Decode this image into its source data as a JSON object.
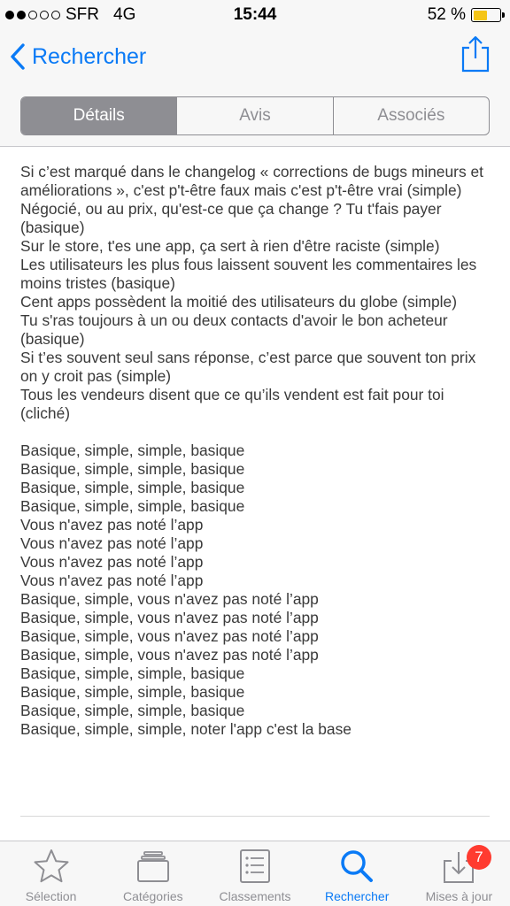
{
  "status_bar": {
    "carrier": "SFR",
    "network": "4G",
    "time": "15:44",
    "battery_text": "52 %",
    "battery_level": 0.52,
    "signal_bars_filled": 2,
    "signal_bars_total": 5
  },
  "nav": {
    "back_label": "Rechercher",
    "back_icon": "chevron-left-icon",
    "share_icon": "share-icon",
    "accent": "#0a7af6"
  },
  "segments": [
    {
      "label": "Détails",
      "active": true
    },
    {
      "label": "Avis",
      "active": false
    },
    {
      "label": "Associés",
      "active": false
    }
  ],
  "description": {
    "verses": [
      "Si c’est marqué dans le changelog « corrections de bugs mineurs et améliorations », c'est p't-être faux mais c'est p't-être vrai (simple)",
      "Négocié, ou au prix, qu'est-ce que ça change ? Tu t'fais payer (basique)",
      "Sur le store, t'es une app, ça sert à rien d'être raciste (simple)",
      "Les utilisateurs les plus fous laissent souvent les commentaires les moins tristes (basique)",
      "Cent apps possèdent la moitié des utilisateurs du globe (simple)",
      "Tu s'ras toujours à un ou deux contacts d'avoir le bon acheteur (basique)",
      "Si t’es souvent seul sans réponse, c’est parce que souvent ton prix on y croit pas (simple)",
      "Tous les vendeurs disent que ce qu’ils vendent est fait pour toi (cliché)"
    ],
    "chorus": [
      "Basique, simple, simple, basique",
      "Basique, simple, simple, basique",
      "Basique, simple, simple, basique",
      "Basique, simple, simple, basique",
      "Vous n'avez pas noté l’app",
      "Vous n'avez pas noté l’app",
      "Vous n'avez pas noté l’app",
      "Vous n'avez pas noté l’app",
      "Basique, simple, vous n'avez pas noté l’app",
      "Basique, simple, vous n'avez pas noté l’app",
      "Basique, simple, vous n'avez pas noté l’app",
      "Basique, simple, vous n'avez pas noté l’app",
      "Basique, simple, simple, basique",
      "Basique, simple, simple, basique",
      "Basique, simple, simple, basique",
      "Basique, simple, simple, noter l'app c'est la base"
    ]
  },
  "tab_bar": {
    "tabs": [
      {
        "label": "Sélection",
        "icon": "star-icon",
        "active": false
      },
      {
        "label": "Catégories",
        "icon": "categories-icon",
        "active": false
      },
      {
        "label": "Classements",
        "icon": "list-icon",
        "active": false
      },
      {
        "label": "Rechercher",
        "icon": "search-icon",
        "active": true
      },
      {
        "label": "Mises à jour",
        "icon": "download-icon",
        "active": false,
        "badge": "7"
      }
    ]
  }
}
